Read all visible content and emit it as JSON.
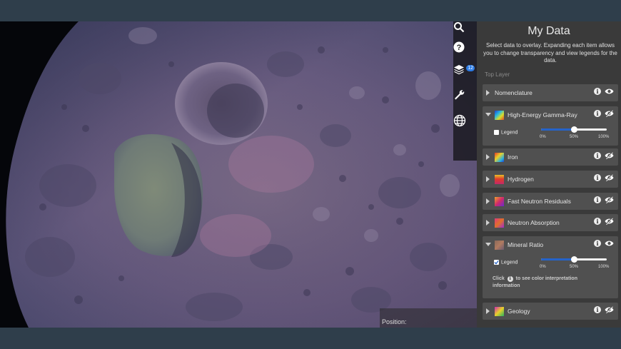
{
  "toolbar": {
    "tools": [
      {
        "icon": "search-icon"
      },
      {
        "icon": "help-icon"
      },
      {
        "icon": "layers-icon",
        "badge": "12"
      },
      {
        "icon": "wrench-icon"
      },
      {
        "icon": "globe-icon"
      }
    ]
  },
  "map": {
    "position_label": "Position:"
  },
  "panel": {
    "title": "My Data",
    "description": "Select data to overlay. Expanding each item allows you to change transparency and view legends for the data.",
    "top_layer_label": "Top Layer",
    "layers": [
      {
        "name": "Nomenclature",
        "expanded": false,
        "visible": true
      },
      {
        "name": "High-Energy Gamma-Ray",
        "expanded": true,
        "visible": false,
        "legend_label": "Legend",
        "legend_checked": false,
        "opacity": 50,
        "tick_labels": [
          "0%",
          "50%",
          "100%"
        ]
      },
      {
        "name": "Iron",
        "expanded": false,
        "visible": false
      },
      {
        "name": "Hydrogen",
        "expanded": false,
        "visible": false
      },
      {
        "name": "Fast Neutron Residuals",
        "expanded": false,
        "visible": false
      },
      {
        "name": "Neutron Absorption",
        "expanded": false,
        "visible": false
      },
      {
        "name": "Mineral Ratio",
        "expanded": true,
        "visible": true,
        "legend_label": "Legend",
        "legend_checked": true,
        "opacity": 50,
        "tick_labels": [
          "0%",
          "50%",
          "100%"
        ],
        "note": "Click  to see color interpretation information"
      },
      {
        "name": "Geology",
        "expanded": false,
        "visible": false
      }
    ]
  },
  "colors": {
    "accent": "#2563c9",
    "panel_bg": "#3a3a3a",
    "layer_bg": "#505050",
    "frame": "#2f3e4b"
  }
}
